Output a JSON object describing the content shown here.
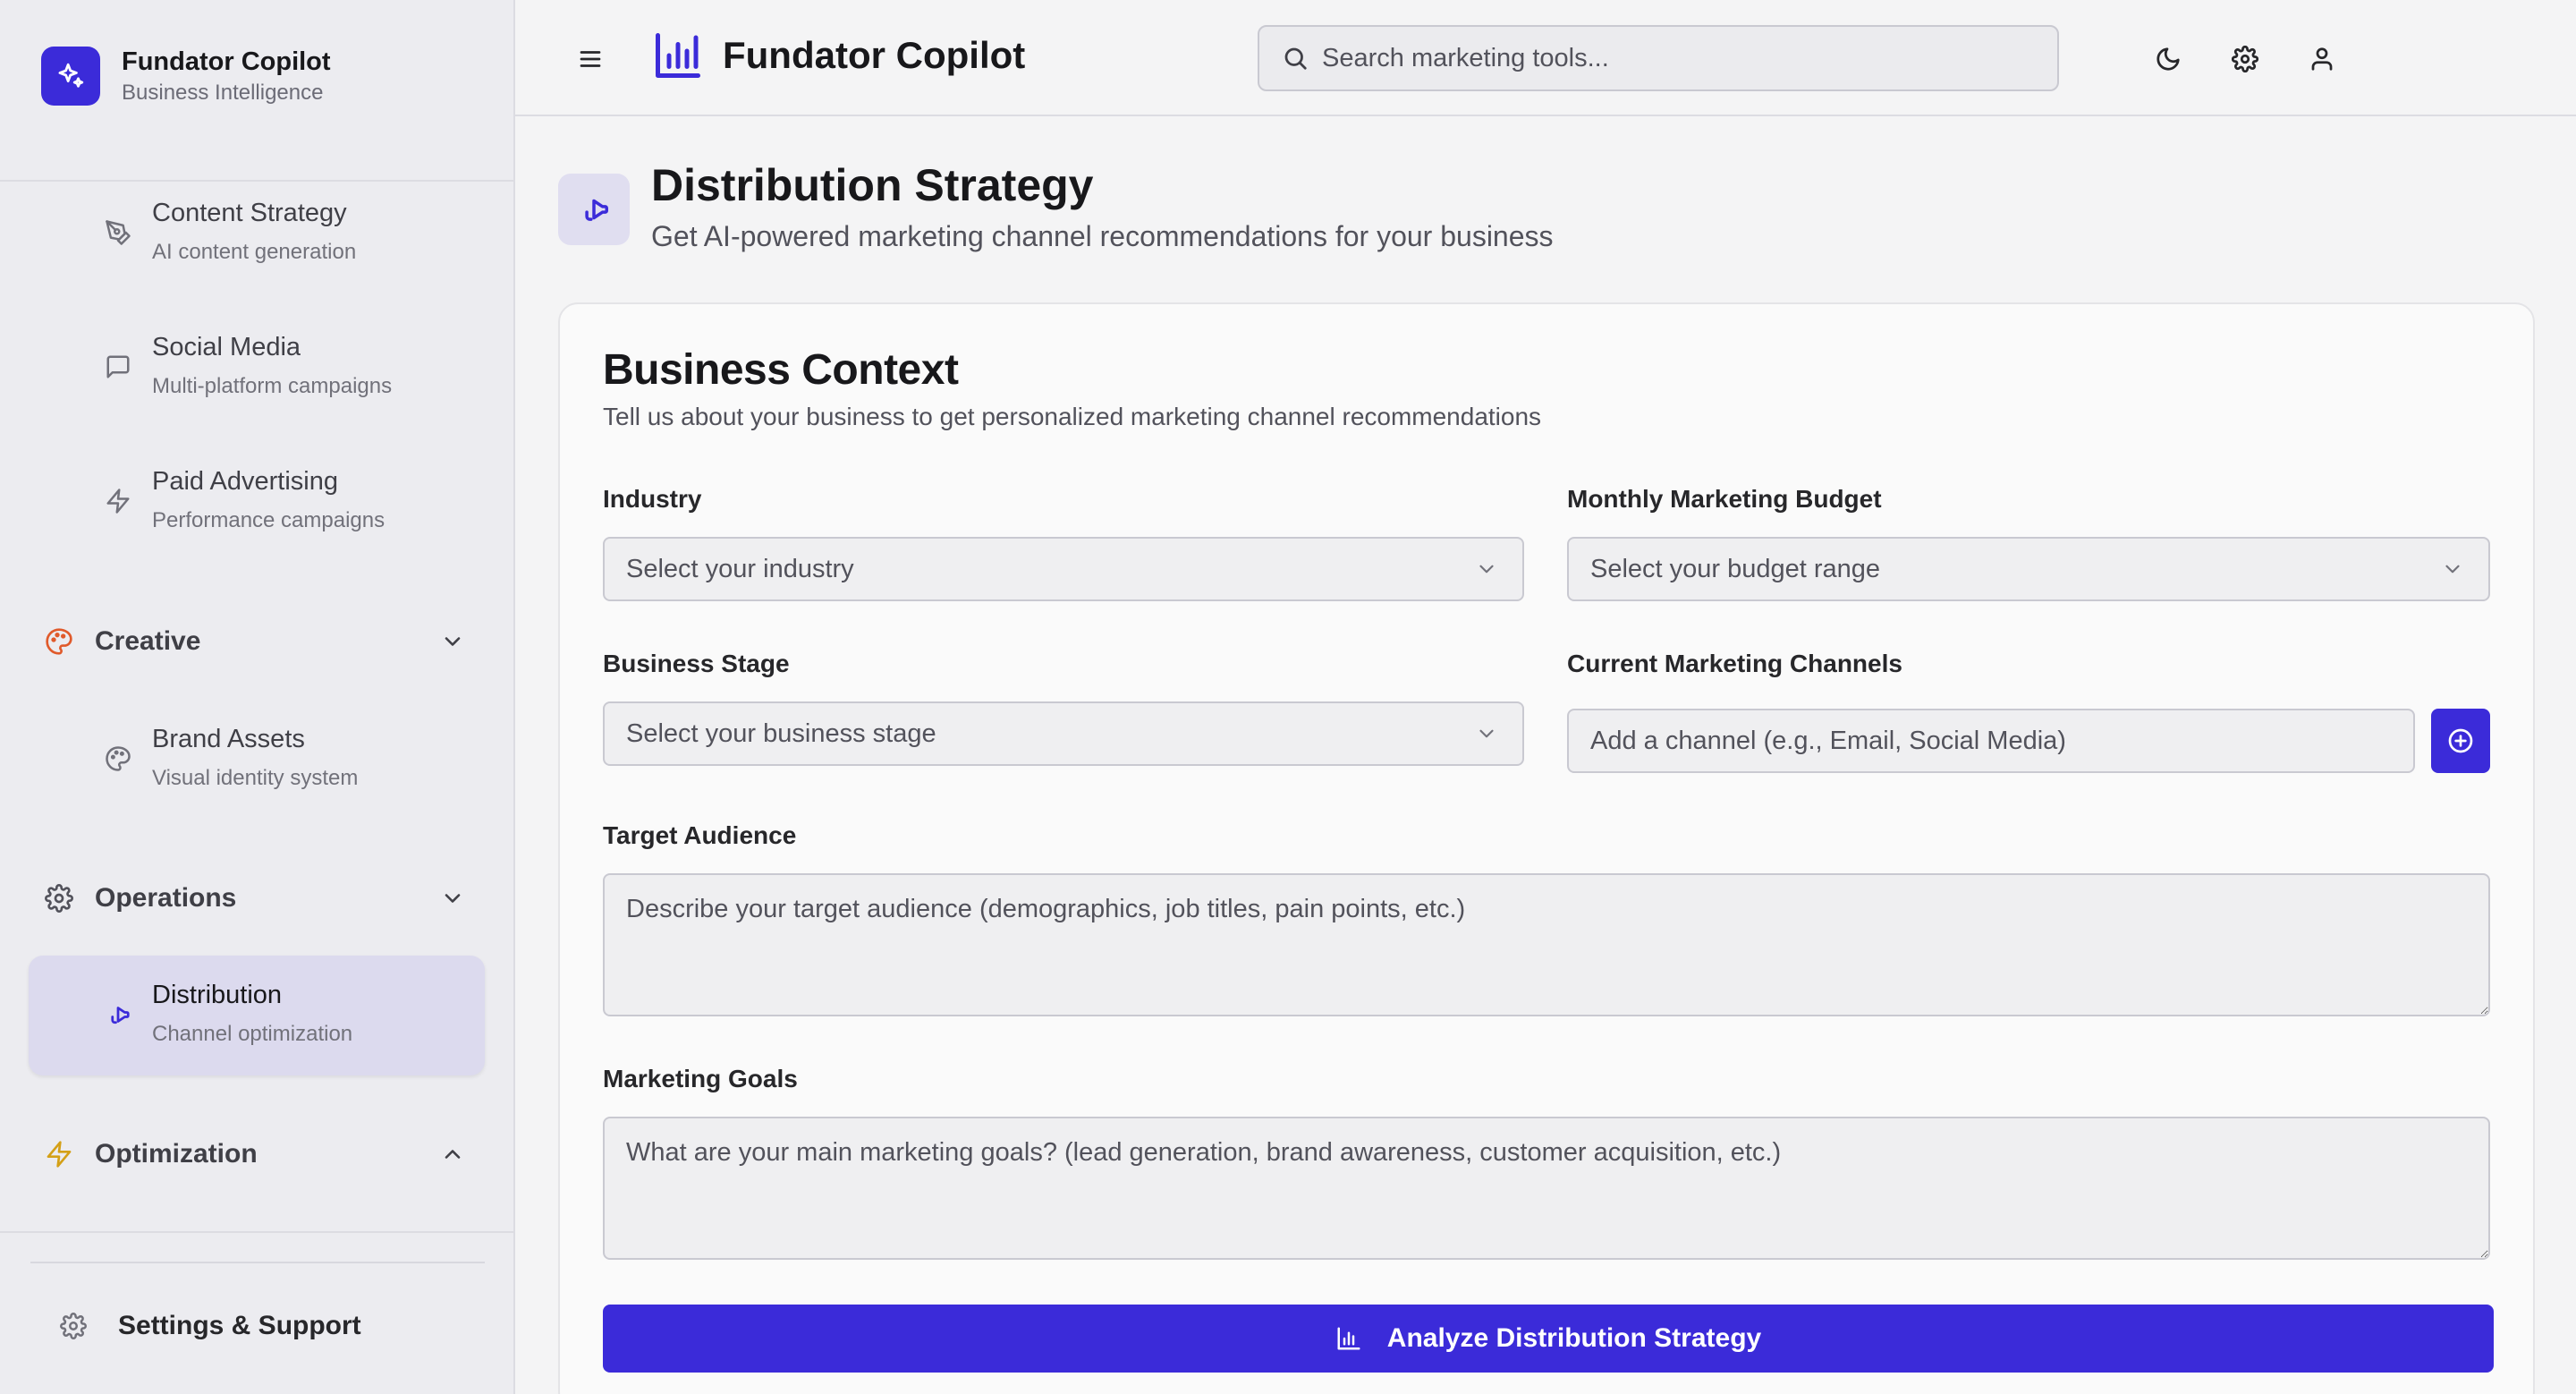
{
  "app": {
    "name": "Fundator Copilot",
    "tagline": "Business Intelligence",
    "accent": "#3b2bd9"
  },
  "sidebar": {
    "items": [
      {
        "title": "Content Strategy",
        "subtitle": "AI content generation",
        "icon": "pen-tool-icon"
      },
      {
        "title": "Social Media",
        "subtitle": "Multi-platform campaigns",
        "icon": "message-square-icon"
      },
      {
        "title": "Paid Advertising",
        "subtitle": "Performance campaigns",
        "icon": "zap-icon"
      },
      {
        "title": "Brand Assets",
        "subtitle": "Visual identity system",
        "icon": "palette-icon"
      },
      {
        "title": "Distribution",
        "subtitle": "Channel optimization",
        "icon": "megaphone-icon",
        "active": true
      }
    ],
    "sections": [
      {
        "label": "Creative",
        "icon": "palette-icon",
        "color": "#e05a2b",
        "expanded": true
      },
      {
        "label": "Operations",
        "icon": "gear-icon",
        "color": "#52525b",
        "expanded": true
      },
      {
        "label": "Optimization",
        "icon": "zap-icon",
        "color": "#d4a017",
        "expanded": false
      }
    ],
    "footer": {
      "label": "Settings & Support",
      "icon": "gear-icon"
    }
  },
  "topbar": {
    "title": "Fundator Copilot",
    "search_placeholder": "Search marketing tools..."
  },
  "page": {
    "title": "Distribution Strategy",
    "subtitle": "Get AI-powered marketing channel recommendations for your business"
  },
  "form": {
    "title": "Business Context",
    "description": "Tell us about your business to get personalized marketing channel recommendations",
    "industry": {
      "label": "Industry",
      "value": "Select your industry"
    },
    "budget": {
      "label": "Monthly Marketing Budget",
      "value": "Select your budget range"
    },
    "stage": {
      "label": "Business Stage",
      "value": "Select your business stage"
    },
    "channels": {
      "label": "Current Marketing Channels",
      "placeholder": "Add a channel (e.g., Email, Social Media)"
    },
    "audience": {
      "label": "Target Audience",
      "placeholder": "Describe your target audience (demographics, job titles, pain points, etc.)"
    },
    "goals": {
      "label": "Marketing Goals",
      "placeholder": "What are your main marketing goals? (lead generation, brand awareness, customer acquisition, etc.)"
    },
    "submit_label": "Analyze Distribution Strategy"
  }
}
